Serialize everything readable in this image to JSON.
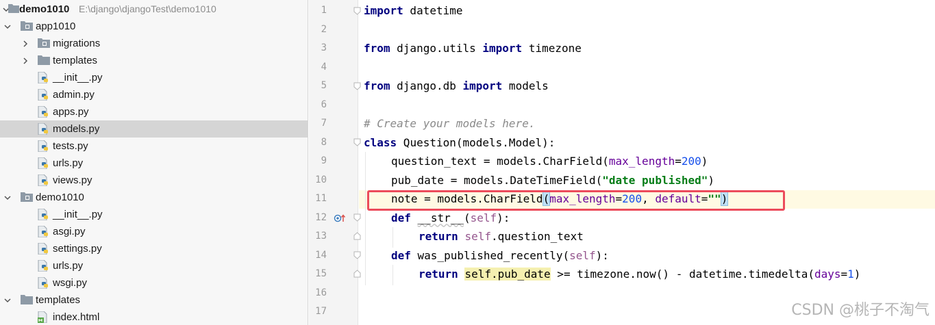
{
  "tree": {
    "root": {
      "name": "demo1010",
      "path": "E:\\django\\djangoTest\\demo1010"
    },
    "items": [
      {
        "label": "app1010"
      },
      {
        "label": "migrations"
      },
      {
        "label": "templates"
      },
      {
        "label": "__init__.py"
      },
      {
        "label": "admin.py"
      },
      {
        "label": "apps.py"
      },
      {
        "label": "models.py"
      },
      {
        "label": "tests.py"
      },
      {
        "label": "urls.py"
      },
      {
        "label": "views.py"
      },
      {
        "label": "demo1010"
      },
      {
        "label": "__init__.py"
      },
      {
        "label": "asgi.py"
      },
      {
        "label": "settings.py"
      },
      {
        "label": "urls.py"
      },
      {
        "label": "wsgi.py"
      },
      {
        "label": "templates"
      },
      {
        "label": "index.html"
      }
    ]
  },
  "editor": {
    "line_numbers": [
      "1",
      "2",
      "3",
      "4",
      "5",
      "6",
      "7",
      "8",
      "9",
      "10",
      "11",
      "12",
      "13",
      "14",
      "15",
      "16",
      "17"
    ],
    "code": {
      "l1": {
        "kw_import": "import",
        "mod": " datetime"
      },
      "l3": {
        "kw_from": "from",
        "mod": " django.utils ",
        "kw_import": "import",
        "name": " timezone"
      },
      "l5": {
        "kw_from": "from",
        "mod": " django.db ",
        "kw_import": "import",
        "name": " models"
      },
      "l7": {
        "comment": "# Create your models here."
      },
      "l8": {
        "kw_class": "class",
        "rest": " Question(models.Model):"
      },
      "l9": {
        "a": "question_text = models.CharField(",
        "param": "max_length",
        "eq": "=",
        "num": "200",
        "close": ")"
      },
      "l10": {
        "a": "pub_date = models.DateTimeField(",
        "str": "\"date published\"",
        "close": ")"
      },
      "l11": {
        "a": "note = models.CharField",
        "open": "(",
        "param1": "max_length",
        "eq1": "=",
        "num": "200",
        "comma": ", ",
        "param2": "default",
        "eq2": "=",
        "str": "\"\"",
        "close": ")"
      },
      "l12": {
        "kw_def": "def",
        "sp": " ",
        "fn": "__str__",
        "open": "(",
        "self": "self",
        "close": "):"
      },
      "l13": {
        "kw_return": "return",
        "sp": " ",
        "self": "self",
        "rest": ".question_text"
      },
      "l14": {
        "kw_def": "def",
        "fn": " was_published_recently(",
        "self": "self",
        "close": "):"
      },
      "l15": {
        "kw_return": "return",
        "sp": " ",
        "self_attr": "self.pub_date",
        "mid": " >= timezone.now() - datetime.timedelta(",
        "param": "days",
        "eq": "=",
        "num": "1",
        "close": ")"
      }
    }
  },
  "watermark": "CSDN @桃子不淘气",
  "colors": {
    "keyword": "#00007f",
    "string": "#067d17",
    "number": "#1750eb",
    "param": "#660099",
    "self": "#94558d",
    "highlight_box": "#ec4b5b",
    "selected_row": "#d5d5d5"
  }
}
